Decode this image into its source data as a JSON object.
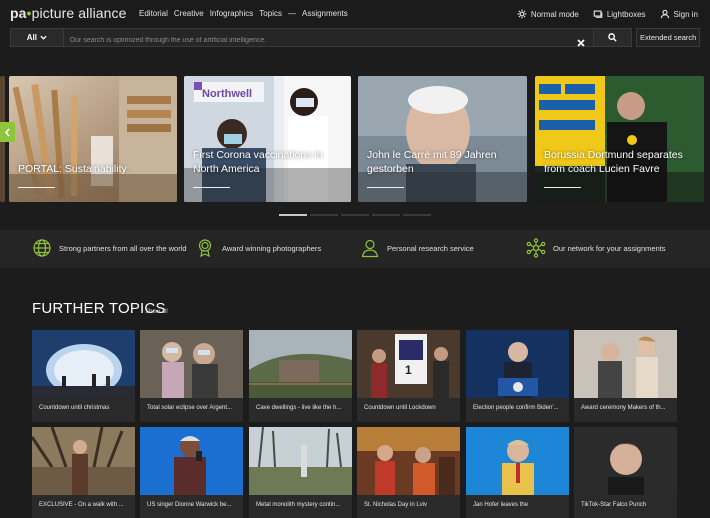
{
  "header": {
    "logo_pa": "pa",
    "logo_rest": "picture alliance",
    "nav": [
      "Editorial",
      "Creative",
      "Infographics",
      "Topics",
      "—",
      "Assignments"
    ],
    "normal_mode": "Normal mode",
    "lightboxes": "Lightboxes",
    "sign_in": "Sign in"
  },
  "search": {
    "scope": "All",
    "placeholder": "Our search is optimized through the use of artificial intelligence.",
    "extended": "Extended search"
  },
  "carousel": {
    "slides": [
      {
        "caption": "PORTAL: Sustainability"
      },
      {
        "caption": "First Corona vaccinations in North America"
      },
      {
        "caption": "John le Carré mit 89 Jahren gestorben"
      },
      {
        "caption": "Borussia Dortmund separates from coach Lucien Favre"
      }
    ],
    "active_index": 0,
    "dot_count": 5
  },
  "features": [
    {
      "icon": "globe-icon",
      "label": "Strong partners from all over the world"
    },
    {
      "icon": "award-icon",
      "label": "Award winning photographers"
    },
    {
      "icon": "person-icon",
      "label": "Personal research service"
    },
    {
      "icon": "network-icon",
      "label": "Our network for your assignments"
    }
  ],
  "further_topics": {
    "title": "FURTHER TOPICS",
    "show_all": "Show all",
    "tiles": [
      "Countdown until christmas",
      "Total solar eclipse over Argent...",
      "Cave dwellings - live like the h...",
      "Countdown until Lockdown",
      "Election people confirm Biden'...",
      "Award ceremony Makers of th...",
      "EXCLUSIVE - On a walk with ...",
      "US singer Dionne Warwick be...",
      "Metal monolith mystery contin...",
      "St. Nicholas Day in Lviv",
      "Jan Hofer leaves the",
      "TikTok-Star Falco Punch"
    ]
  },
  "colors": {
    "accent": "#8fc43b",
    "background": "#1c1c1c"
  }
}
